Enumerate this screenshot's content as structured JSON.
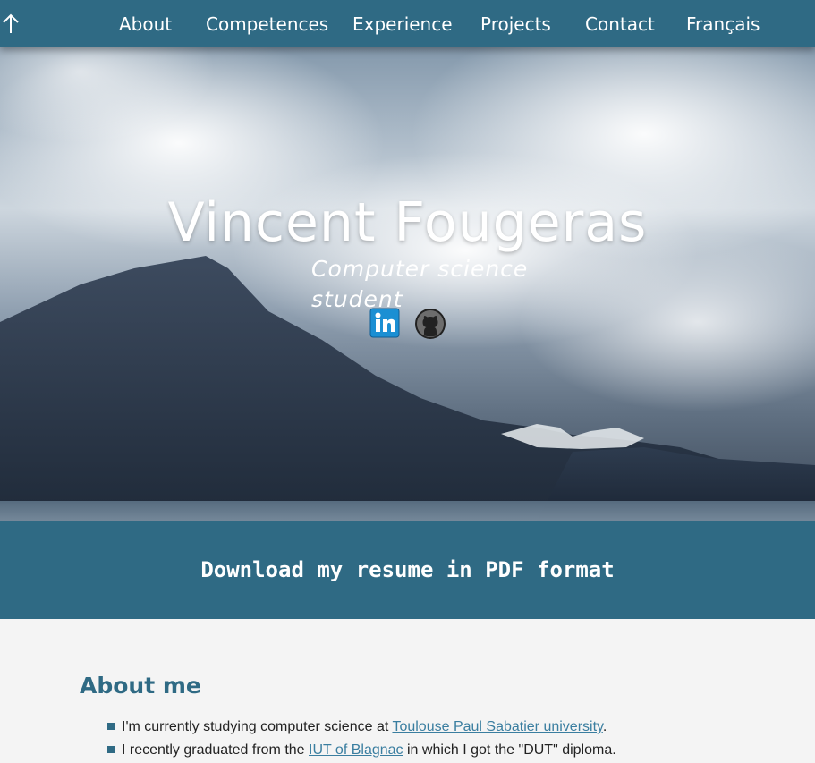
{
  "nav": {
    "top_icon": "arrow-up-icon",
    "items": [
      {
        "label": "About"
      },
      {
        "label": "Competences"
      },
      {
        "label": "Experience"
      },
      {
        "label": "Projects"
      },
      {
        "label": "Contact"
      },
      {
        "label": "Français"
      }
    ]
  },
  "hero": {
    "title": "Vincent Fougeras",
    "subtitle": "Computer science student",
    "social": [
      {
        "icon": "linkedin-icon"
      },
      {
        "icon": "github-icon"
      }
    ]
  },
  "resume": {
    "label": "Download my resume in PDF format"
  },
  "about": {
    "title": "About me",
    "items": [
      {
        "before": "I'm currently studying computer science at ",
        "link": "Toulouse Paul Sabatier university",
        "after": "."
      },
      {
        "before": "I recently graduated from the ",
        "link": "IUT of Blagnac",
        "after": " in which I got the \"DUT\" diploma."
      }
    ]
  },
  "colors": {
    "primary": "#2f6a84",
    "link": "#3a7ea0",
    "text": "#222222",
    "background": "#f4f4f4"
  }
}
